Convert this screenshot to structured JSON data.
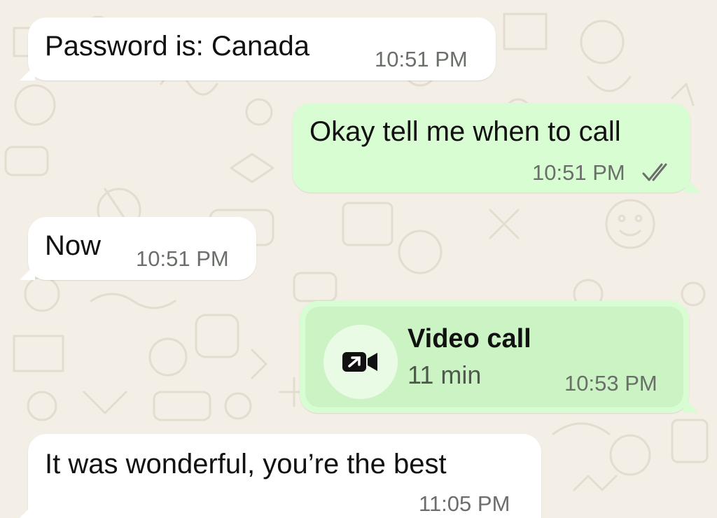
{
  "colors": {
    "wallpaper": "#f3eee6",
    "doodle": "#e3dccf",
    "incoming_bubble": "#ffffff",
    "outgoing_bubble": "#d9fdd3",
    "call_card": "#ccf3c4",
    "timestamp": "#6b6f6a"
  },
  "messages": [
    {
      "direction": "incoming",
      "text": "Password is: Canada",
      "time": "10:51 PM"
    },
    {
      "direction": "outgoing",
      "text": "Okay tell me when to call",
      "time": "10:51 PM",
      "status_icon": "double-check-icon"
    },
    {
      "direction": "incoming",
      "text": "Now",
      "time": "10:51 PM"
    },
    {
      "direction": "outgoing",
      "type": "video-call",
      "icon": "video-camera-outgoing-icon",
      "title": "Video call",
      "duration": "11 min",
      "time": "10:53 PM"
    },
    {
      "direction": "incoming",
      "text": "It was wonderful, you’re the best",
      "time": "11:05 PM"
    }
  ]
}
